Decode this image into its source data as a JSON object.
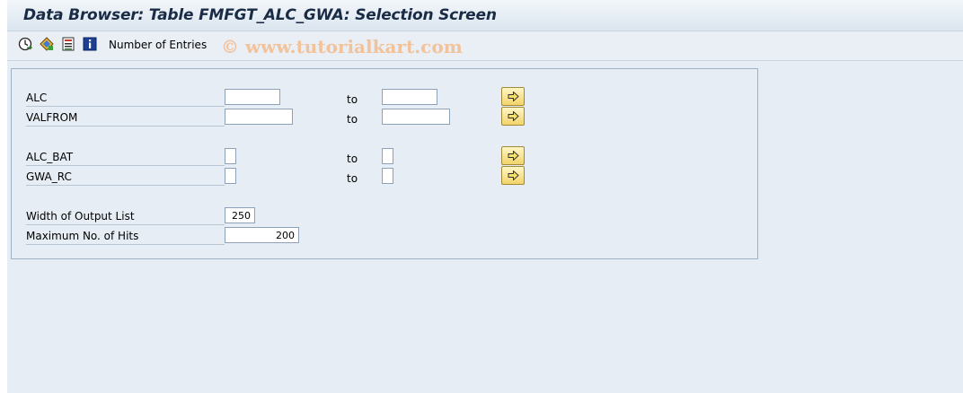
{
  "window": {
    "title": "Data Browser: Table FMFGT_ALC_GWA: Selection Screen"
  },
  "toolbar": {
    "icons": [
      "execute-icon",
      "selection-options-icon",
      "get-variant-icon",
      "info-icon"
    ],
    "number_of_entries_label": "Number of Entries",
    "watermark": "© www.tutorialkart.com"
  },
  "selection": {
    "fields": [
      {
        "label": "ALC",
        "low": "",
        "to_label": "to",
        "high": ""
      },
      {
        "label": "VALFROM",
        "low": "",
        "to_label": "to",
        "high": ""
      },
      {
        "label": "ALC_BAT",
        "low": "",
        "to_label": "to",
        "high": ""
      },
      {
        "label": "GWA_RC",
        "low": "",
        "to_label": "to",
        "high": ""
      }
    ],
    "width_of_output_list": {
      "label": "Width of Output List",
      "value": "250"
    },
    "maximum_hits": {
      "label": "Maximum No. of Hits",
      "value": "200"
    }
  },
  "colors": {
    "background": "#e6edf4",
    "more_button": "#f3d46a"
  }
}
